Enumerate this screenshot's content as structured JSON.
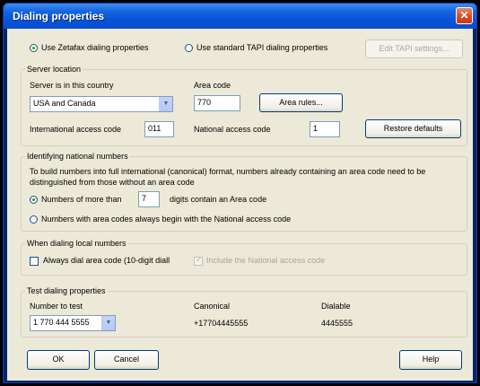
{
  "window": {
    "title": "Dialing properties",
    "close_glyph": "✕"
  },
  "mode": {
    "zetafax_label": "Use Zetafax dialing properties",
    "tapi_label": "Use standard TAPI dialing properties",
    "edit_tapi_label": "Edit TAPI settings..."
  },
  "server_location": {
    "legend": "Server location",
    "country_label": "Server is in this country",
    "country_value": "USA and Canada",
    "area_code_label": "Area code",
    "area_code_value": "770",
    "area_rules_label": "Area rules...",
    "intl_label": "International access code",
    "intl_value": "011",
    "national_label": "National access code",
    "national_value": "1",
    "restore_label": "Restore defaults"
  },
  "identifying": {
    "legend": "Identifying national numbers",
    "desc_line1": "To build numbers into full international (canonical) format, numbers already containing an area code need to be",
    "desc_line2": "distinguished from those without an area code",
    "option1_prefix": "Numbers of more than",
    "option1_value": "7",
    "option1_suffix": "digits contain an Area code",
    "option2_label": "Numbers with area codes always begin with the National access code"
  },
  "local": {
    "legend": "When dialing local numbers",
    "always_dial_label": "Always dial area code (10-digit diall",
    "include_national_label": "Include the National access code"
  },
  "test": {
    "legend": "Test dialing properties",
    "number_header": "Number to test",
    "number_value": "1 770 444 5555",
    "canonical_header": "Canonical",
    "canonical_value": "+17704445555",
    "dialable_header": "Dialable",
    "dialable_value": "4445555"
  },
  "footer": {
    "ok_label": "OK",
    "cancel_label": "Cancel",
    "help_label": "Help"
  },
  "icons": {
    "dropdown": "▼"
  }
}
